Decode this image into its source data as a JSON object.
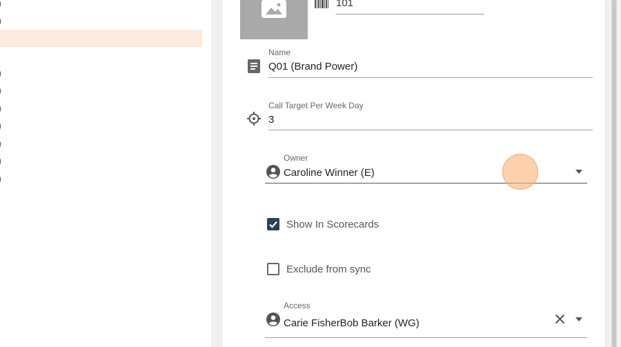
{
  "left_list": {
    "rows": [
      ")",
      ")",
      ")",
      ")",
      ")",
      ")",
      ")",
      ")",
      ")"
    ]
  },
  "form": {
    "code_value": "101",
    "name": {
      "label": "Name",
      "value": "Q01 (Brand Power)"
    },
    "call_target": {
      "label": "Call Target Per Week Day",
      "value": "3"
    },
    "owner": {
      "label": "Owner",
      "value": "Caroline Winner (E)"
    },
    "show_in_scorecards": {
      "label": "Show In Scorecards",
      "checked": true
    },
    "exclude_from_sync": {
      "label": "Exclude from sync",
      "checked": false
    },
    "access": {
      "label": "Access",
      "value": "Carie FisherBob Barker (WG)"
    }
  },
  "colors": {
    "accent_dark": "#2f3f55",
    "selected_row": "#fde9df",
    "cursor_highlight": "#fcb278"
  },
  "icons": [
    "image-placeholder-icon",
    "barcode-icon",
    "document-icon",
    "crosshair-icon",
    "person-circle-icon",
    "dropdown-arrow-icon",
    "clear-icon",
    "checkbox-checked-icon",
    "checkbox-unchecked-icon"
  ]
}
